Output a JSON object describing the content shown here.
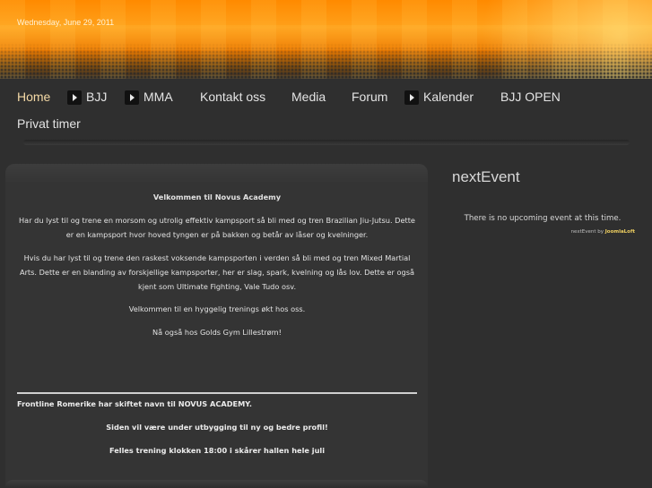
{
  "header": {
    "date": "Wednesday, June 29, 2011"
  },
  "nav": {
    "items": [
      {
        "label": "Home",
        "arrow": false,
        "active": true
      },
      {
        "label": "BJJ",
        "arrow": true
      },
      {
        "label": "MMA",
        "arrow": true
      },
      {
        "label": "Kontakt oss",
        "arrow": false
      },
      {
        "label": "Media",
        "arrow": false
      },
      {
        "label": "Forum",
        "arrow": false
      },
      {
        "label": "Kalender",
        "arrow": true
      },
      {
        "label": "BJJ OPEN",
        "arrow": false
      },
      {
        "label": "Privat timer",
        "arrow": false
      }
    ]
  },
  "main": {
    "welcome_title": "Velkommen til Novus Academy",
    "p1": "Har du lyst til og trene en morsom og utrolig effektiv kampsport så bli med og tren Brazilian Jiu-Jutsu. Dette er en kampsport hvor hoved tyngen er på bakken og betår av låser og kvelninger.",
    "p2": "Hvis du har lyst til og trene den raskest voksende kampsporten i verden så bli med og tren Mixed Martial Arts. Dette er en blanding av forskjellige kampsporter, her er slag, spark, kvelning og lås lov. Dette er også kjent som Ultimate Fighting, Vale Tudo osv.",
    "p3": "Velkommen til en hyggelig trenings økt hos oss.",
    "p4": "Nå også hos Golds Gym Lillestrøm!",
    "news_title": "Frontline Romerike har skiftet navn til NOVUS ACADEMY.",
    "news_line1": "Siden vil være under utbygging til ny og bedre profil!",
    "news_line2": "Felles trening klokken 18:00 i skårer hallen hele juli"
  },
  "sidebar": {
    "title": "nextEvent",
    "no_event": "There is no upcoming event at this time.",
    "credit_prefix": "nextEvent by ",
    "credit_brand": "JoomlaLoft"
  }
}
